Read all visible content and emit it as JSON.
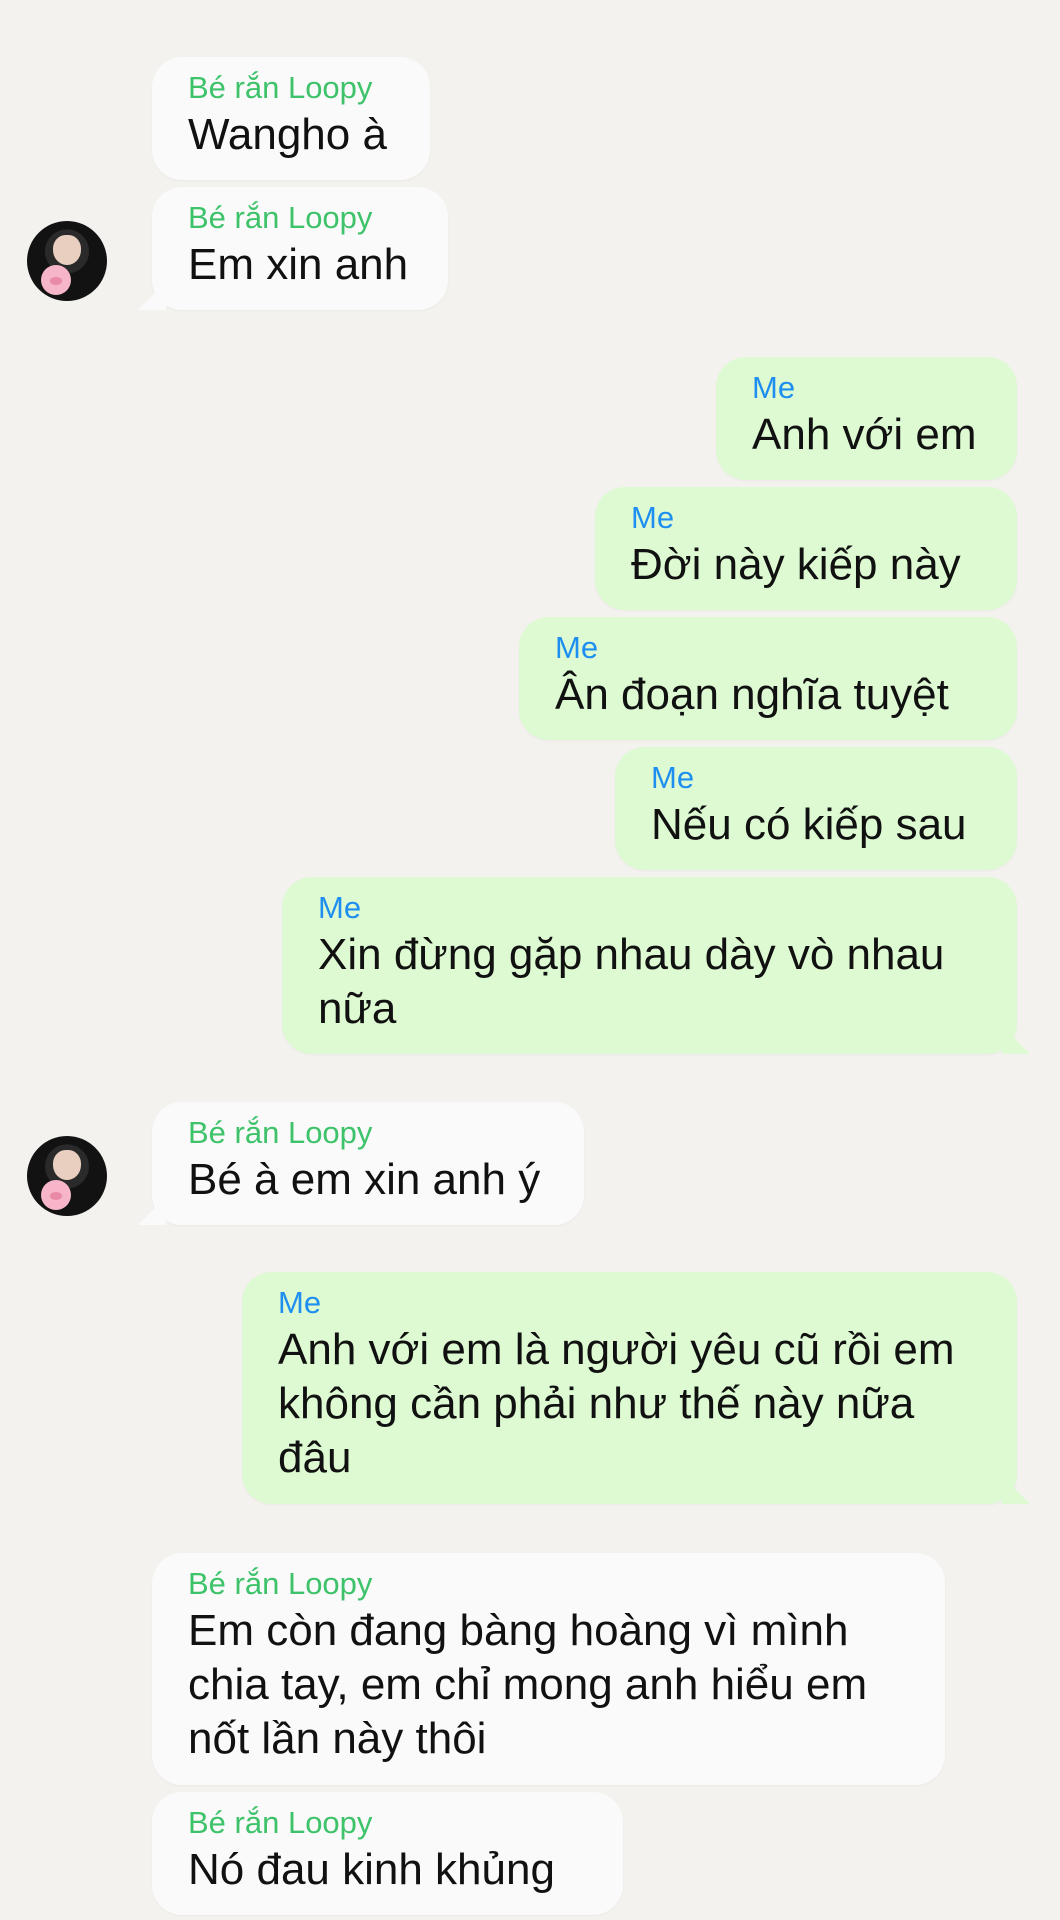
{
  "contact_name": "Bé rắn Loopy",
  "me_name": "Me",
  "messages": [
    {
      "sender": "Bé rắn Loopy",
      "text": "Wangho à"
    },
    {
      "sender": "Bé rắn Loopy",
      "text": "Em xin anh"
    },
    {
      "sender": "Me",
      "text": "Anh với em"
    },
    {
      "sender": "Me",
      "text": "Đời này kiếp này"
    },
    {
      "sender": "Me",
      "text": "Ân đoạn nghĩa tuyệt"
    },
    {
      "sender": "Me",
      "text": "Nếu có kiếp sau"
    },
    {
      "sender": "Me",
      "text": "Xin đừng gặp nhau dày vò nhau nữa"
    },
    {
      "sender": "Bé rắn Loopy",
      "text": "Bé à em xin anh ý"
    },
    {
      "sender": "Me",
      "text": "Anh với em là người yêu cũ rồi em không cần phải như thế này nữa đâu"
    },
    {
      "sender": "Bé rắn Loopy",
      "text": "Em còn đang bàng hoàng vì mình chia tay, em chỉ mong anh hiểu em nốt lần này thôi"
    },
    {
      "sender": "Bé rắn Loopy",
      "text": "Nó đau kinh khủng"
    }
  ],
  "colors": {
    "background": "#f4f2ee",
    "incoming_bubble": "#fafafa",
    "outgoing_bubble": "#ddfad2",
    "incoming_sender": "#3ec26a",
    "outgoing_sender": "#1e8ff0",
    "message_text": "#111111"
  },
  "icons": {
    "avatar": "contact-avatar-photo"
  }
}
